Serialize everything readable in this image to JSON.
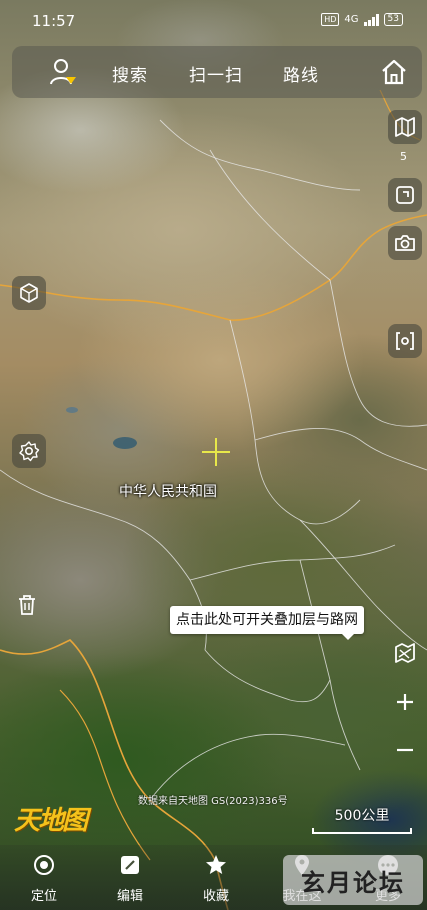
{
  "status_bar": {
    "time": "11:57",
    "hd": "HD",
    "network": "4G",
    "battery": "53"
  },
  "top_toolbar": {
    "search": "搜索",
    "scan": "扫一扫",
    "route": "路线"
  },
  "map": {
    "zoom_level": "5",
    "country_label": "中华人民共和国",
    "overlay_tip": "点击此处可开关叠加层与路网",
    "attribution": "数据来自天地图 GS(2023)336号",
    "logo": "天地图",
    "scale_label": "500公里"
  },
  "bottom_nav": {
    "items": [
      {
        "label": "定位",
        "icon": "locate-icon"
      },
      {
        "label": "编辑",
        "icon": "edit-icon"
      },
      {
        "label": "收藏",
        "icon": "star-icon"
      },
      {
        "label": "我在这",
        "icon": "pin-icon"
      },
      {
        "label": "更多",
        "icon": "more-icon"
      }
    ]
  },
  "watermark": "玄月论坛",
  "colors": {
    "border": "#e6a53a",
    "province_line": "#e8e8e8",
    "logo": "#f5c21b",
    "crosshair": "#e8e84a"
  }
}
